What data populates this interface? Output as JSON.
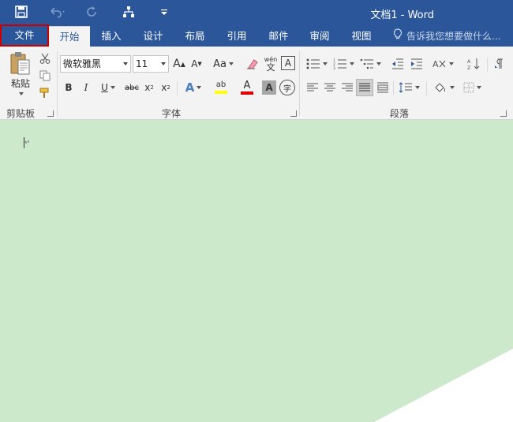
{
  "window": {
    "title": "文档1 - Word"
  },
  "titlebar_icons": [
    "save-icon",
    "undo-icon",
    "redo-icon",
    "touch-mode-icon",
    "customize-qat-icon"
  ],
  "tabs": [
    {
      "label": "文件",
      "name": "file"
    },
    {
      "label": "开始",
      "name": "home"
    },
    {
      "label": "插入",
      "name": "insert"
    },
    {
      "label": "设计",
      "name": "design"
    },
    {
      "label": "布局",
      "name": "layout"
    },
    {
      "label": "引用",
      "name": "references"
    },
    {
      "label": "邮件",
      "name": "mailings"
    },
    {
      "label": "审阅",
      "name": "review"
    },
    {
      "label": "视图",
      "name": "view"
    }
  ],
  "active_tab": "开始",
  "tell_me": {
    "placeholder": "告诉我您想要做什么..."
  },
  "clipboard": {
    "paste_label": "粘贴",
    "group_label": "剪贴板"
  },
  "font": {
    "name": "微软雅黑",
    "size": "11",
    "group_label": "字体",
    "buttons": {
      "grow": "A",
      "shrink": "A",
      "case": "Aa",
      "bold": "B",
      "italic": "I",
      "underline": "U",
      "strike": "abc",
      "subscript": "x",
      "superscript": "x",
      "text_effects": "A",
      "highlight": "ab",
      "font_color": "A",
      "char_shading": "A",
      "enclose": "字",
      "phonetic_top": "wén",
      "phonetic_bottom": "文",
      "char_border": "A"
    }
  },
  "paragraph": {
    "group_label": "段落"
  },
  "colors": {
    "brand": "#2b579a",
    "ribbon": "#f3f3f3",
    "doc_bg": "#cce9cc",
    "highlight": "#ffff00",
    "font_color": "#e00000",
    "file_outline": "#cc0000"
  }
}
